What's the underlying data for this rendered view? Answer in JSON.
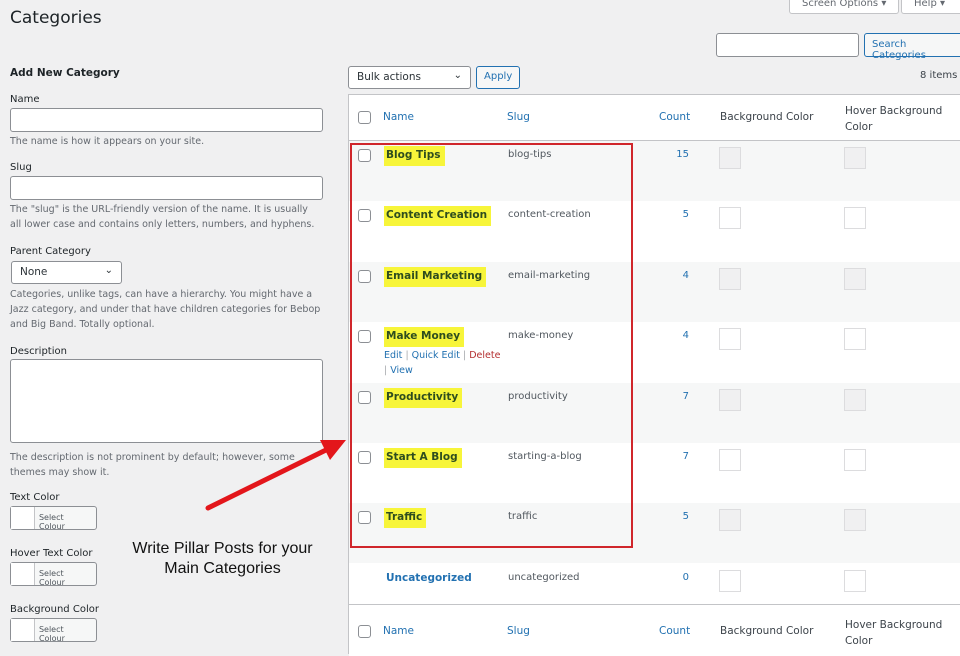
{
  "page_title": "Categories",
  "screen_options": "Screen Options ▾",
  "help": "Help ▾",
  "search": {
    "value": "",
    "button": "Search Categories"
  },
  "form": {
    "heading": "Add New Category",
    "name_label": "Name",
    "name_help": "The name is how it appears on your site.",
    "slug_label": "Slug",
    "slug_help": "The \"slug\" is the URL-friendly version of the name. It is usually all lower case and contains only letters, numbers, and hyphens.",
    "parent_label": "Parent Category",
    "parent_value": "None",
    "parent_help": "Categories, unlike tags, can have a hierarchy. You might have a Jazz category, and under that have children categories for Bebop and Big Band. Totally optional.",
    "desc_label": "Description",
    "desc_help": "The description is not prominent by default; however, some themes may show it.",
    "text_color_label": "Text Color",
    "hover_text_color_label": "Hover Text Color",
    "bg_color_label": "Background Color",
    "select_colour": "Select Colour"
  },
  "bulk": {
    "value": "Bulk actions",
    "apply": "Apply",
    "items": "8 items"
  },
  "columns": {
    "name": "Name",
    "slug": "Slug",
    "count": "Count",
    "bg": "Background Color",
    "hover_bg": "Hover Background Color"
  },
  "row_actions": {
    "edit": "Edit",
    "quick_edit": "Quick Edit",
    "delete": "Delete",
    "view": "View",
    "sep": "|"
  },
  "rows": [
    {
      "name": "Blog Tips",
      "slug": "blog-tips",
      "count": "15"
    },
    {
      "name": "Content Creation",
      "slug": "content-creation",
      "count": "5"
    },
    {
      "name": "Email Marketing",
      "slug": "email-marketing",
      "count": "4"
    },
    {
      "name": "Make Money",
      "slug": "make-money",
      "count": "4"
    },
    {
      "name": "Productivity",
      "slug": "productivity",
      "count": "7"
    },
    {
      "name": "Start A Blog",
      "slug": "starting-a-blog",
      "count": "7"
    },
    {
      "name": "Traffic",
      "slug": "traffic",
      "count": "5"
    },
    {
      "name": "Uncategorized",
      "slug": "uncategorized",
      "count": "0"
    }
  ],
  "annotation": {
    "line1": "Write Pillar Posts for your",
    "line2": "Main Categories",
    "color": "#e3161b"
  },
  "colors": {
    "highlight": "#f7f53a",
    "link": "#2271b1",
    "box": "#d0262b"
  }
}
